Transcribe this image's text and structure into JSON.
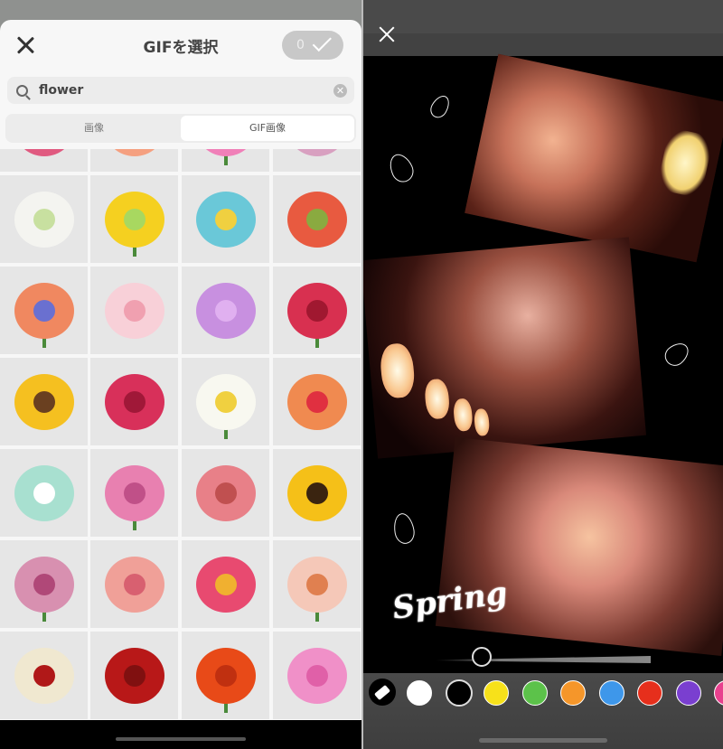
{
  "left": {
    "header": {
      "title": "GIFを選択",
      "selected_count": "0",
      "close_icon": "close-icon",
      "confirm_icon": "check-icon"
    },
    "search": {
      "value": "flower",
      "placeholder": ""
    },
    "tabs": [
      {
        "label": "画像",
        "active": false
      },
      {
        "label": "GIF画像",
        "active": true
      }
    ],
    "stickers": [
      {
        "color": "#e05a80",
        "center": "#c03a60"
      },
      {
        "color": "#f5a080",
        "center": "#e08a30"
      },
      {
        "color": "#f080b8",
        "center": "#f5d040"
      },
      {
        "color": "#d8a0c0",
        "center": "#a05a80"
      },
      {
        "color": "#f4f4f0",
        "center": "#c8e0a0"
      },
      {
        "color": "#f5d020",
        "center": "#a8d860"
      },
      {
        "color": "#6ac8d8",
        "center": "#f0d040"
      },
      {
        "color": "#e85a40",
        "center": "#8aaa40"
      },
      {
        "color": "#f08860",
        "center": "#6a70d0"
      },
      {
        "color": "#f8d0d8",
        "center": "#f0a0b0"
      },
      {
        "color": "#c890e0",
        "center": "#e0b0f0"
      },
      {
        "color": "#d83050",
        "center": "#a01830"
      },
      {
        "color": "#f5c020",
        "center": "#6a4020"
      },
      {
        "color": "#d8305a",
        "center": "#a01838"
      },
      {
        "color": "#f8f8f0",
        "center": "#f0d040"
      },
      {
        "color": "#f08a50",
        "center": "#e03040"
      },
      {
        "color": "#a8e0d0",
        "center": "#ffffff"
      },
      {
        "color": "#e880b0",
        "center": "#c05088"
      },
      {
        "color": "#e88088",
        "center": "#c05050"
      },
      {
        "color": "#f5c018",
        "center": "#3a2410"
      },
      {
        "color": "#d890b0",
        "center": "#b04878"
      },
      {
        "color": "#f0a098",
        "center": "#d86070"
      },
      {
        "color": "#e84a70",
        "center": "#f0b030"
      },
      {
        "color": "#f5c8b8",
        "center": "#e08050"
      },
      {
        "color": "#f0e8d0",
        "center": "#b01818"
      },
      {
        "color": "#b81818",
        "center": "#801010"
      },
      {
        "color": "#e84a18",
        "center": "#c03010"
      },
      {
        "color": "#f090c8",
        "center": "#e060a8"
      }
    ]
  },
  "right": {
    "close_icon": "close-icon",
    "sticker_text": "Spring",
    "brush_size": 0.1,
    "palette": {
      "eraser_icon": "eraser-icon",
      "colors": [
        "#ffffff",
        "#000000",
        "#f7e11a",
        "#5cc24a",
        "#f5962a",
        "#3e97ea",
        "#e62f1c",
        "#7a3fd0",
        "#e8408e"
      ],
      "selected": "#000000"
    }
  }
}
